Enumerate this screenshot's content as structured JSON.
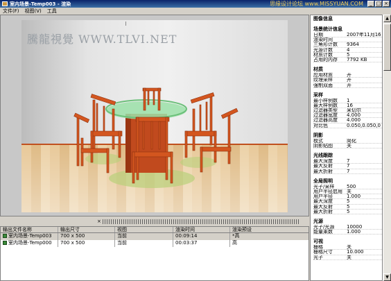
{
  "window": {
    "title": "室内场景-Temp003 - 渲染",
    "watermark": "思缘设计论坛 www.MISSYUAN.COM",
    "controls": [
      "_",
      "□",
      "×"
    ]
  },
  "menu": [
    "文件(F)",
    "视图(V)",
    "工具"
  ],
  "viewport": {
    "watermark": "騰龍視覺 WWW.TLVI.NET"
  },
  "splitter": {
    "close_glyph": "×"
  },
  "queue": {
    "columns": [
      "输出文件名称",
      "输出尺寸",
      "视图",
      "渲染时间",
      "渲染预设"
    ],
    "rows": [
      {
        "name": "室内场景-Temp003",
        "size": "700 x 500",
        "view": "当前",
        "time": "00:09:14",
        "preset": "*高"
      },
      {
        "name": "室内场景-Temp000",
        "size": "700 x 500",
        "view": "当前",
        "time": "00:03:37",
        "preset": "高"
      }
    ]
  },
  "properties": {
    "sections": [
      {
        "title": "图像信息",
        "rows": []
      },
      {
        "title": "场景统计信息",
        "rows": [
          {
            "k": "日期",
            "v": "2007年11月16"
          },
          {
            "k": "渲染时间",
            "v": ""
          },
          {
            "k": "三角形计数",
            "v": "9364"
          },
          {
            "k": "光源计数",
            "v": "4"
          },
          {
            "k": "材质计数",
            "v": "5"
          },
          {
            "k": "占用的内存",
            "v": "7792 KB"
          }
        ]
      },
      {
        "title": "材质",
        "rows": [
          {
            "k": "应用材质",
            "v": "开"
          },
          {
            "k": "纹理采样",
            "v": "开"
          },
          {
            "k": "强制双面",
            "v": "开"
          }
        ]
      },
      {
        "title": "采样",
        "rows": [
          {
            "k": "最小样例数",
            "v": "1"
          },
          {
            "k": "最大样例数",
            "v": "16"
          },
          {
            "k": "过滤器类型",
            "v": "米切尔"
          },
          {
            "k": "过滤器宽度",
            "v": "4.000"
          },
          {
            "k": "过滤器高度",
            "v": "4.000"
          },
          {
            "k": "对比色",
            "v": "0.050,0.050,0"
          }
        ]
      },
      {
        "title": "阴影",
        "rows": [
          {
            "k": "模式",
            "v": "简化"
          },
          {
            "k": "阴影贴图",
            "v": "关"
          }
        ]
      },
      {
        "title": "光线跟踪",
        "rows": [
          {
            "k": "最大深度",
            "v": "7"
          },
          {
            "k": "最大反射",
            "v": "7"
          },
          {
            "k": "最大折射",
            "v": "7"
          }
        ]
      },
      {
        "title": "全局照明",
        "rows": [
          {
            "k": "光子/采样",
            "v": "500"
          },
          {
            "k": "用户半径启用",
            "v": "关"
          },
          {
            "k": "用户半径",
            "v": "1.000"
          },
          {
            "k": "最大深度",
            "v": "5"
          },
          {
            "k": "最大反射",
            "v": "5"
          },
          {
            "k": "最大折射",
            "v": "5"
          }
        ]
      },
      {
        "title": "光源",
        "rows": [
          {
            "k": "光子/光源",
            "v": "10000"
          },
          {
            "k": "能量乘数",
            "v": "1.000"
          }
        ]
      },
      {
        "title": "可视",
        "rows": [
          {
            "k": "栅格",
            "v": "关"
          },
          {
            "k": "栅格尺寸",
            "v": "10.000"
          },
          {
            "k": "光子",
            "v": "关"
          }
        ]
      }
    ]
  },
  "scrollbar": {
    "up": "▲",
    "down": "▼"
  }
}
